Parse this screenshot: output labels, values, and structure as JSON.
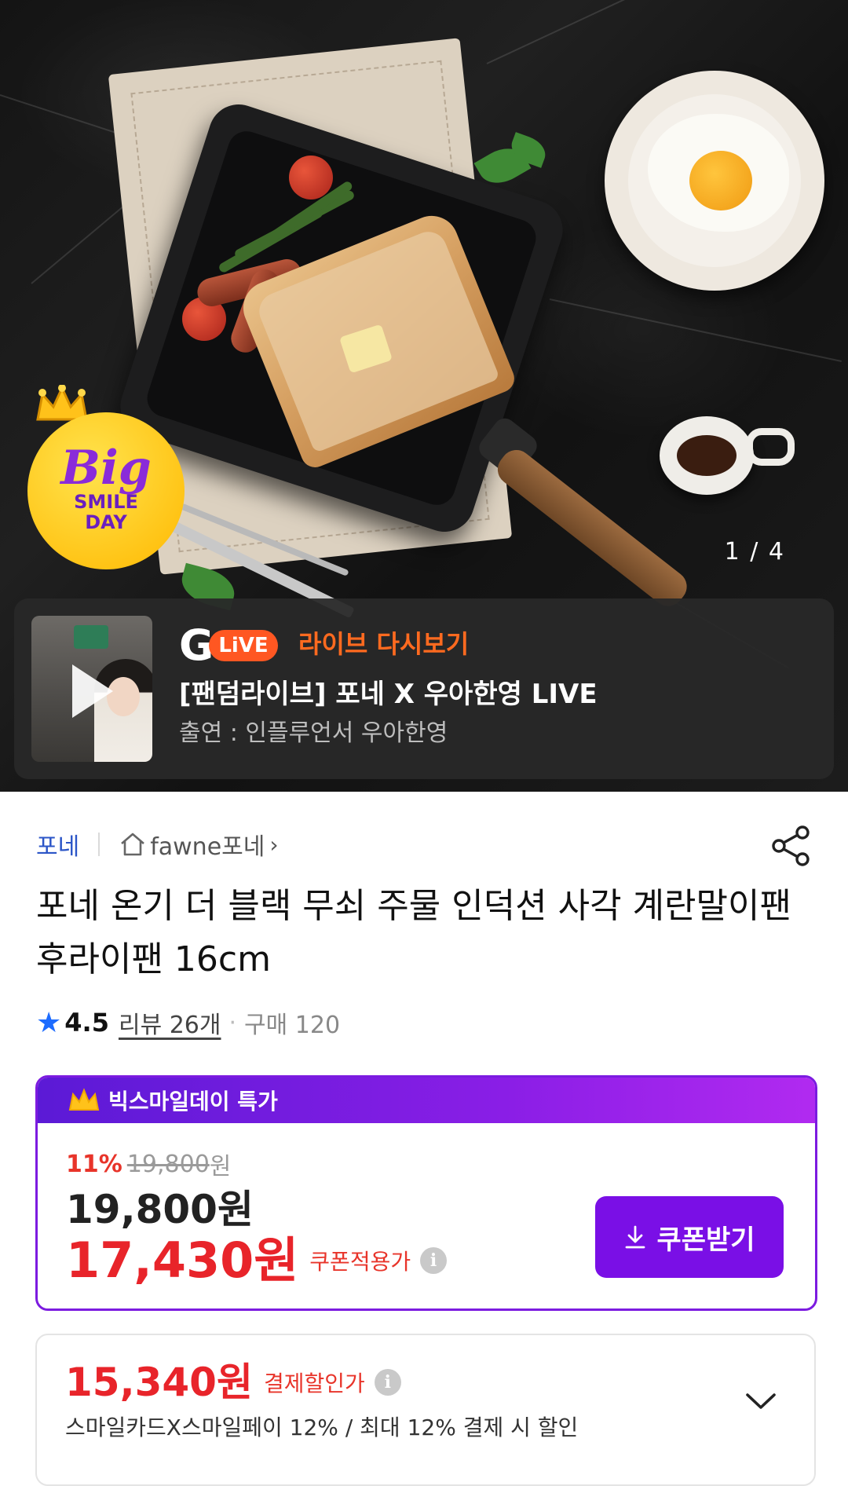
{
  "hero": {
    "badge": {
      "big": "Big",
      "smile": "SMILE",
      "day": "DAY"
    },
    "pager": "1 / 4",
    "live": {
      "logo_g": "G",
      "logo_live": "LiVE",
      "replay_label": "라이브 다시보기",
      "title": "[팬덤라이브] 포네 X 우아한영 LIVE",
      "subtitle": "출연 : 인플루언서 우아한영"
    }
  },
  "product": {
    "brand": "포네",
    "shop": "fawne포네",
    "title": "포네 온기 더 블랙 무쇠 주물 인덕션 사각 계란말이팬 후라이팬 16cm",
    "rating": "4.5",
    "review": "리뷰 26개",
    "purchase": "구매 120"
  },
  "deal": {
    "header": "빅스마일데이 특가",
    "discount_pct": "11%",
    "original_price": "19,800",
    "original_unit": "원",
    "price": "19,800원",
    "coupon_price": "17,430원",
    "coupon_label": "쿠폰적용가",
    "coupon_button": "쿠폰받기"
  },
  "payment": {
    "price": "15,340원",
    "label": "결제할인가",
    "description": "스마일카드X스마일페이 12% / 최대 12% 결제 시 할인"
  },
  "colors": {
    "accent_purple": "#7a0fe6",
    "price_red": "#e8242a",
    "brand_blue": "#2b55c7",
    "live_orange": "#ff5722"
  }
}
